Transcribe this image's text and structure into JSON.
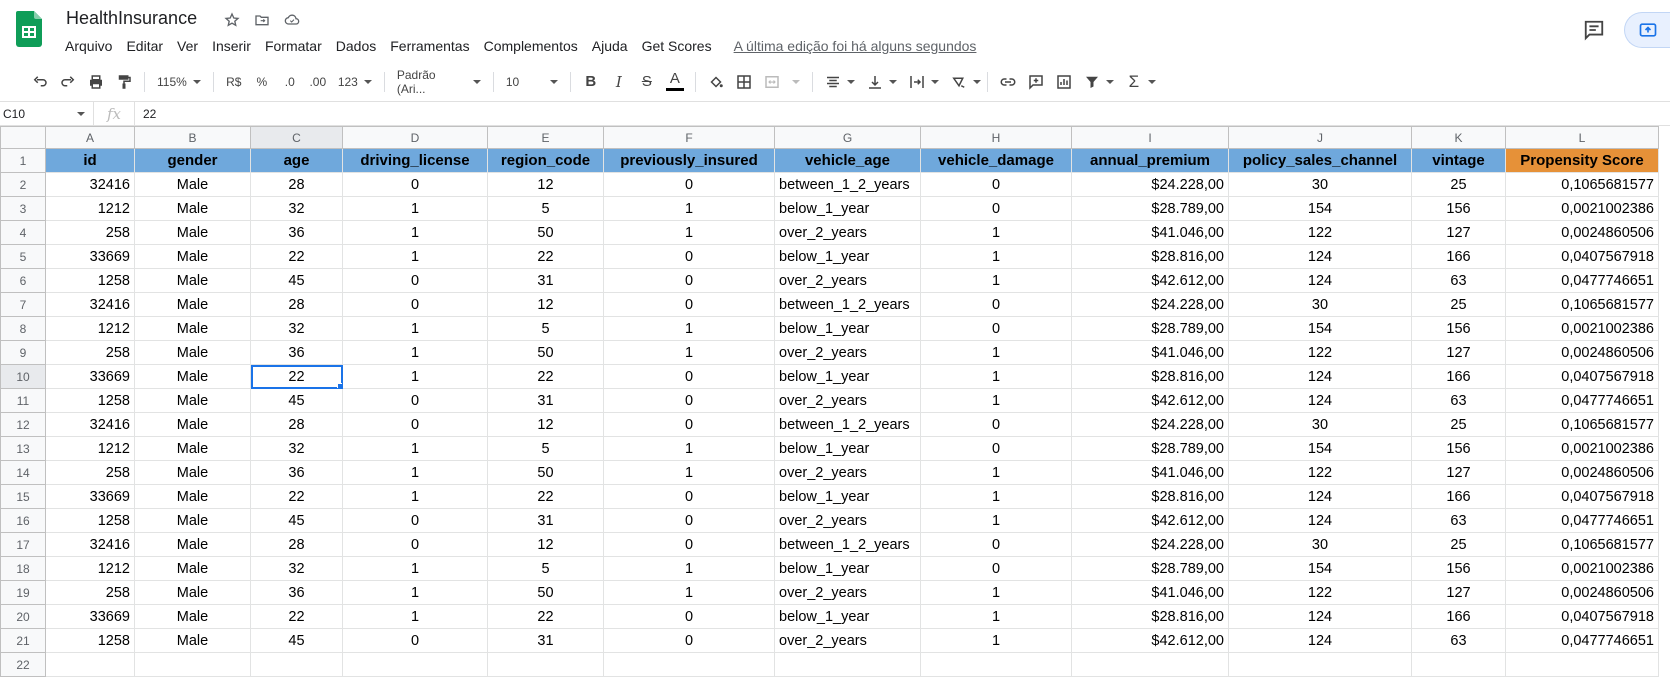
{
  "app": {
    "title": "HealthInsurance",
    "menu": [
      "Arquivo",
      "Editar",
      "Ver",
      "Inserir",
      "Formatar",
      "Dados",
      "Ferramentas",
      "Complementos",
      "Ajuda",
      "Get Scores"
    ],
    "last_edit": "A última edição foi há alguns segundos"
  },
  "toolbar": {
    "zoom": "115%",
    "currency": "R$",
    "percent": "%",
    "dec_decrease": ".0",
    "dec_increase": ".00",
    "format_more": "123",
    "font": "Padrão (Ari...",
    "font_size": "10"
  },
  "formula_bar": {
    "cell_ref": "C10",
    "fx": "fx",
    "value": "22"
  },
  "columns": [
    "A",
    "B",
    "C",
    "D",
    "E",
    "F",
    "G",
    "H",
    "I",
    "J",
    "K",
    "L"
  ],
  "headers": [
    "id",
    "gender",
    "age",
    "driving_license",
    "region_code",
    "previously_insured",
    "vehicle_age",
    "vehicle_damage",
    "annual_premium",
    "policy_sales_channel",
    "vintage",
    "Propensity Score"
  ],
  "rows": [
    [
      "32416",
      "Male",
      "28",
      "0",
      "12",
      "0",
      "between_1_2_years",
      "0",
      "$24.228,00",
      "30",
      "25",
      "0,1065681577"
    ],
    [
      "1212",
      "Male",
      "32",
      "1",
      "5",
      "1",
      "below_1_year",
      "0",
      "$28.789,00",
      "154",
      "156",
      "0,0021002386"
    ],
    [
      "258",
      "Male",
      "36",
      "1",
      "50",
      "1",
      "over_2_years",
      "1",
      "$41.046,00",
      "122",
      "127",
      "0,0024860506"
    ],
    [
      "33669",
      "Male",
      "22",
      "1",
      "22",
      "0",
      "below_1_year",
      "1",
      "$28.816,00",
      "124",
      "166",
      "0,0407567918"
    ],
    [
      "1258",
      "Male",
      "45",
      "0",
      "31",
      "0",
      "over_2_years",
      "1",
      "$42.612,00",
      "124",
      "63",
      "0,0477746651"
    ],
    [
      "32416",
      "Male",
      "28",
      "0",
      "12",
      "0",
      "between_1_2_years",
      "0",
      "$24.228,00",
      "30",
      "25",
      "0,1065681577"
    ],
    [
      "1212",
      "Male",
      "32",
      "1",
      "5",
      "1",
      "below_1_year",
      "0",
      "$28.789,00",
      "154",
      "156",
      "0,0021002386"
    ],
    [
      "258",
      "Male",
      "36",
      "1",
      "50",
      "1",
      "over_2_years",
      "1",
      "$41.046,00",
      "122",
      "127",
      "0,0024860506"
    ],
    [
      "33669",
      "Male",
      "22",
      "1",
      "22",
      "0",
      "below_1_year",
      "1",
      "$28.816,00",
      "124",
      "166",
      "0,0407567918"
    ],
    [
      "1258",
      "Male",
      "45",
      "0",
      "31",
      "0",
      "over_2_years",
      "1",
      "$42.612,00",
      "124",
      "63",
      "0,0477746651"
    ],
    [
      "32416",
      "Male",
      "28",
      "0",
      "12",
      "0",
      "between_1_2_years",
      "0",
      "$24.228,00",
      "30",
      "25",
      "0,1065681577"
    ],
    [
      "1212",
      "Male",
      "32",
      "1",
      "5",
      "1",
      "below_1_year",
      "0",
      "$28.789,00",
      "154",
      "156",
      "0,0021002386"
    ],
    [
      "258",
      "Male",
      "36",
      "1",
      "50",
      "1",
      "over_2_years",
      "1",
      "$41.046,00",
      "122",
      "127",
      "0,0024860506"
    ],
    [
      "33669",
      "Male",
      "22",
      "1",
      "22",
      "0",
      "below_1_year",
      "1",
      "$28.816,00",
      "124",
      "166",
      "0,0407567918"
    ],
    [
      "1258",
      "Male",
      "45",
      "0",
      "31",
      "0",
      "over_2_years",
      "1",
      "$42.612,00",
      "124",
      "63",
      "0,0477746651"
    ],
    [
      "32416",
      "Male",
      "28",
      "0",
      "12",
      "0",
      "between_1_2_years",
      "0",
      "$24.228,00",
      "30",
      "25",
      "0,1065681577"
    ],
    [
      "1212",
      "Male",
      "32",
      "1",
      "5",
      "1",
      "below_1_year",
      "0",
      "$28.789,00",
      "154",
      "156",
      "0,0021002386"
    ],
    [
      "258",
      "Male",
      "36",
      "1",
      "50",
      "1",
      "over_2_years",
      "1",
      "$41.046,00",
      "122",
      "127",
      "0,0024860506"
    ],
    [
      "33669",
      "Male",
      "22",
      "1",
      "22",
      "0",
      "below_1_year",
      "1",
      "$28.816,00",
      "124",
      "166",
      "0,0407567918"
    ],
    [
      "1258",
      "Male",
      "45",
      "0",
      "31",
      "0",
      "over_2_years",
      "1",
      "$42.612,00",
      "124",
      "63",
      "0,0477746651"
    ]
  ],
  "colors": {
    "header_blue": "#6fa8dc",
    "header_orange": "#e69138",
    "selection": "#1a73e8",
    "sheets_green": "#0f9d58"
  }
}
